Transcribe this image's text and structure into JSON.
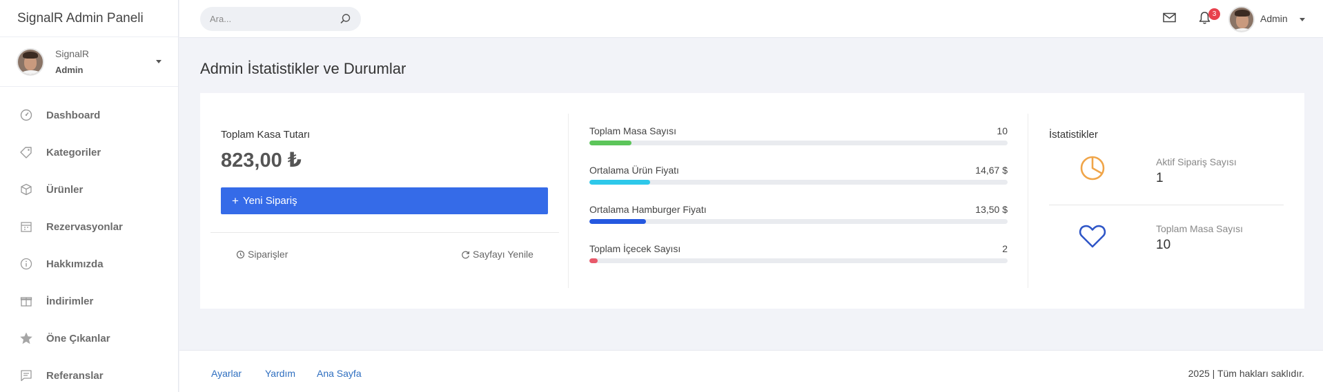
{
  "brand": "SignalR Admin Paneli",
  "user": {
    "name": "SignalR",
    "role": "Admin"
  },
  "sidebar": {
    "items": [
      {
        "label": "Dashboard",
        "icon": "gauge-icon"
      },
      {
        "label": "Kategoriler",
        "icon": "tag-icon"
      },
      {
        "label": "Ürünler",
        "icon": "box-icon"
      },
      {
        "label": "Rezervasyonlar",
        "icon": "calendar-icon"
      },
      {
        "label": "Hakkımızda",
        "icon": "info-icon"
      },
      {
        "label": "İndirimler",
        "icon": "gift-icon"
      },
      {
        "label": "Öne Çıkanlar",
        "icon": "star-icon"
      },
      {
        "label": "Referanslar",
        "icon": "comment-icon"
      }
    ]
  },
  "header": {
    "search_placeholder": "Ara...",
    "notification_count": "3",
    "user_label": "Admin"
  },
  "main": {
    "title": "Admin İstatistikler ve Durumlar",
    "kasa": {
      "label": "Toplam Kasa Tutarı",
      "value": "823,00 ₺",
      "button": "Yeni Sipariş",
      "link_orders": "Siparişler",
      "link_refresh": "Sayfayı Yenile"
    },
    "progress": [
      {
        "label": "Toplam Masa Sayısı",
        "value": "10",
        "fraction": 0.1,
        "color": "#5cc55a"
      },
      {
        "label": "Ortalama Ürün Fiyatı",
        "value": "14,67 $",
        "fraction": 0.145,
        "color": "#2ec8ea"
      },
      {
        "label": "Ortalama Hamburger Fiyatı",
        "value": "13,50 $",
        "fraction": 0.135,
        "color": "#2558e0"
      },
      {
        "label": "Toplam İçecek Sayısı",
        "value": "2",
        "fraction": 0.02,
        "color": "#e8596a"
      }
    ],
    "stats": {
      "title": "İstatistikler",
      "items": [
        {
          "label": "Aktif Sipariş Sayısı",
          "value": "1",
          "icon": "pie-chart-icon",
          "color": "#f0a549"
        },
        {
          "label": "Toplam Masa Sayısı",
          "value": "10",
          "icon": "heart-icon",
          "color": "#2f56c7"
        }
      ]
    }
  },
  "footer": {
    "links": [
      "Ayarlar",
      "Yardım",
      "Ana Sayfa"
    ],
    "copyright": "2025 | Tüm hakları saklıdır."
  }
}
